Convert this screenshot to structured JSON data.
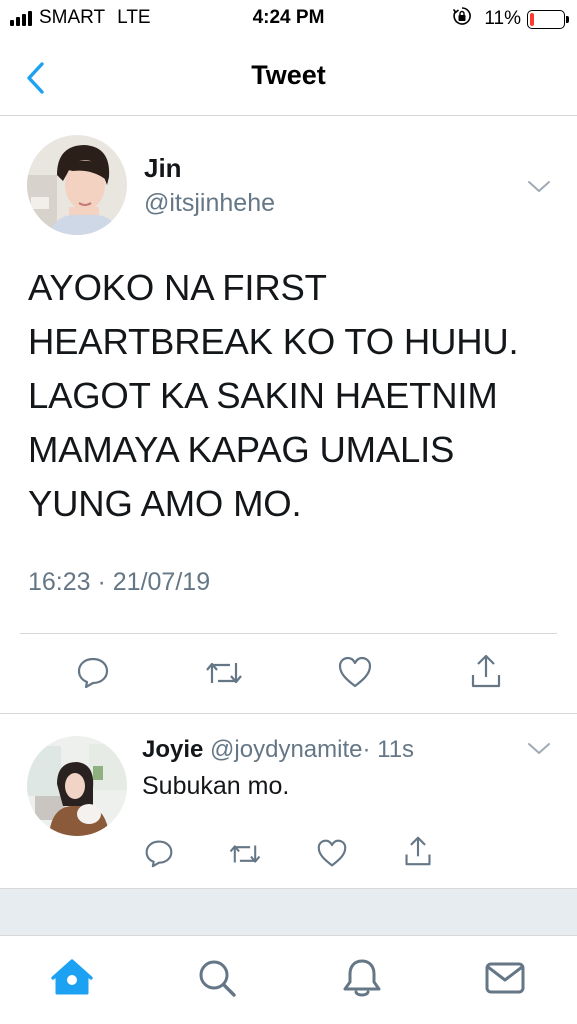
{
  "status_bar": {
    "carrier": "SMART",
    "network": "LTE",
    "time": "4:24 PM",
    "battery": "11%",
    "battery_level": 0.11,
    "battery_color": "#ff3b30"
  },
  "nav": {
    "back_icon": "chevron-left-icon",
    "title": "Tweet"
  },
  "main_tweet": {
    "author_name": "Jin",
    "author_handle": "@itsjinhehe",
    "text": "AYOKO NA FIRST\nHEARTBREAK KO TO HUHU.\nLAGOT KA SAKIN HAETNIM\nMAMAYA KAPAG UMALIS\nYUNG AMO MO.",
    "timestamp": "16:23 · 21/07/19",
    "actions": [
      "reply-icon",
      "retweet-icon",
      "like-icon",
      "share-icon"
    ]
  },
  "reply": {
    "author_name": "Joyie",
    "author_handle": "@joydynamite",
    "time": "· 11s",
    "text": "Subukan mo.",
    "actions": [
      "reply-icon",
      "retweet-icon",
      "like-icon",
      "share-icon"
    ]
  },
  "tab_bar": {
    "tabs": [
      "home-icon",
      "search-icon",
      "notifications-icon",
      "messages-icon"
    ],
    "active": "home-icon"
  },
  "colors": {
    "accent": "#1da1f2",
    "text": "#14171a",
    "secondary": "#657786",
    "divider": "#d8d8d8"
  }
}
